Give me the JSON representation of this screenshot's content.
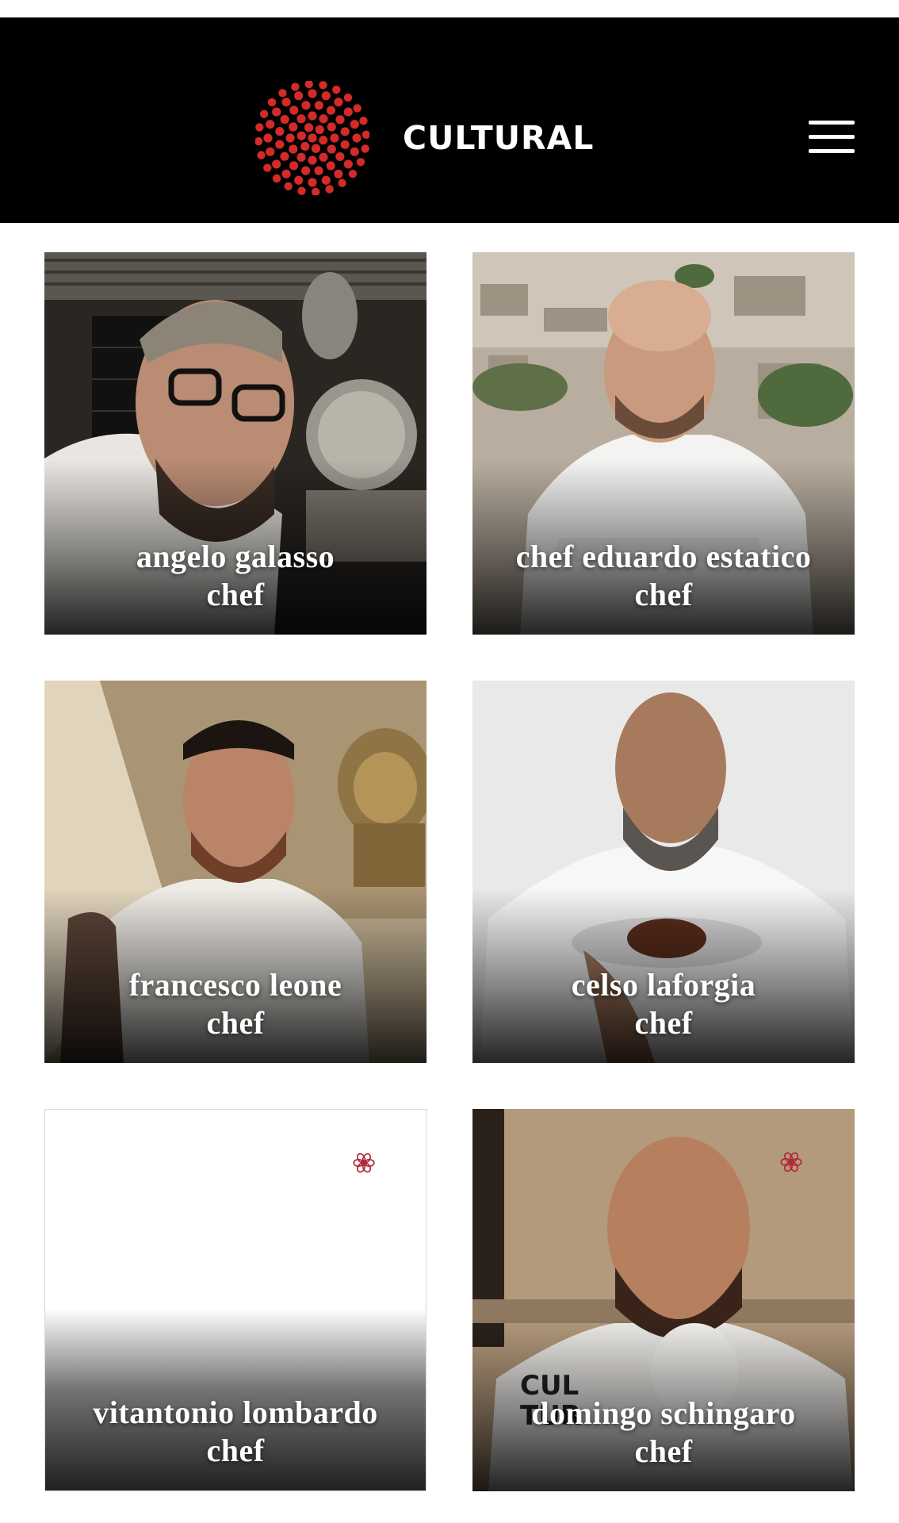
{
  "header": {
    "brand": "CULTURAL",
    "logo": "red-dot-circle-logo",
    "menu_icon": "hamburger-menu-icon",
    "accent_color": "#d32a2a"
  },
  "cards": [
    {
      "name": "angelo galasso",
      "role": "chef"
    },
    {
      "name": "chef eduardo estatico",
      "role": "chef"
    },
    {
      "name": "francesco leone",
      "role": "chef"
    },
    {
      "name": "celso laforgia",
      "role": "chef"
    },
    {
      "name": "vitantonio lombardo",
      "role": "chef",
      "badge_icon": "michelin-star-icon"
    },
    {
      "name": "domingo schingaro",
      "role": "chef",
      "badge_icon": "michelin-star-icon"
    }
  ]
}
